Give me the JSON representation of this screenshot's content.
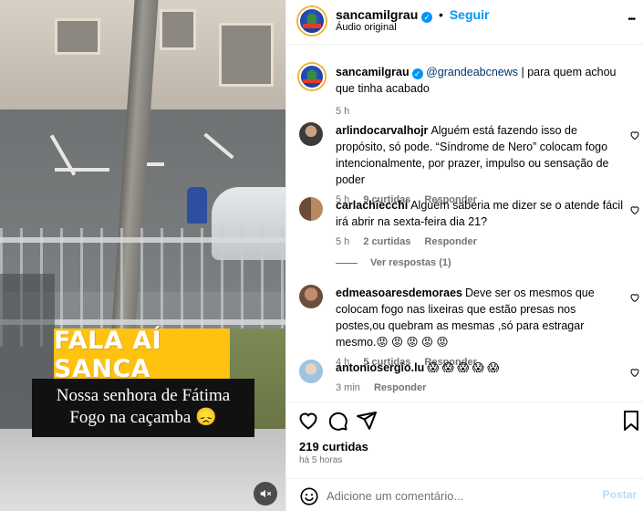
{
  "video": {
    "caption_title": "FALA AÍ SANCA",
    "caption_line1": "Nossa senhora de Fátima",
    "caption_line2": "Fogo na caçamba 😞",
    "mute_icon": "speaker-muted-icon"
  },
  "header": {
    "username": "sancamilgrau",
    "verified": "✓",
    "separator": "•",
    "follow_label": "Seguir",
    "audio_label": "Áudio original",
    "more_label": "•••"
  },
  "caption": {
    "username": "sancamilgrau",
    "mention": "@grandeabcnews",
    "text": " | para quem achou que tinha acabado",
    "time": "5 h"
  },
  "comments": [
    {
      "username": "arlindocarvalhojr",
      "text": "Alguém está fazendo isso de propósito, só pode. “Síndrome de Nero” colocam fogo intencionalmente, por prazer, impulso ou sensação de poder",
      "time": "5 h",
      "likes": "9 curtidas",
      "reply": "Responder"
    },
    {
      "username": "carlachiecchi",
      "text": "Alguém saberia me dizer se o atende fácil irá abrir na sexta-feira dia 21?",
      "time": "5 h",
      "likes": "2 curtidas",
      "reply": "Responder",
      "view_replies": "Ver respostas (1)"
    },
    {
      "username": "edmeasoaresdemoraes",
      "text": "Deve ser os mesmos que colocam fogo nas lixeiras que estão presas nos postes,ou quebram as mesmas ,só para estragar mesmo.😡 😡 😡 😡 😡",
      "time": "4 h",
      "likes": "5 curtidas",
      "reply": "Responder"
    },
    {
      "username": "antoniosergio.lu",
      "text": "😱 😱 😱 😱 😱",
      "time": "3 min",
      "reply": "Responder"
    }
  ],
  "footer": {
    "likes": "219 curtidas",
    "time_ago": "há 5 horas",
    "comment_placeholder": "Adicione um comentário...",
    "post_label": "Postar"
  },
  "colors": {
    "accent": "#0095f6",
    "caption_yellow": "#ffc20e"
  }
}
